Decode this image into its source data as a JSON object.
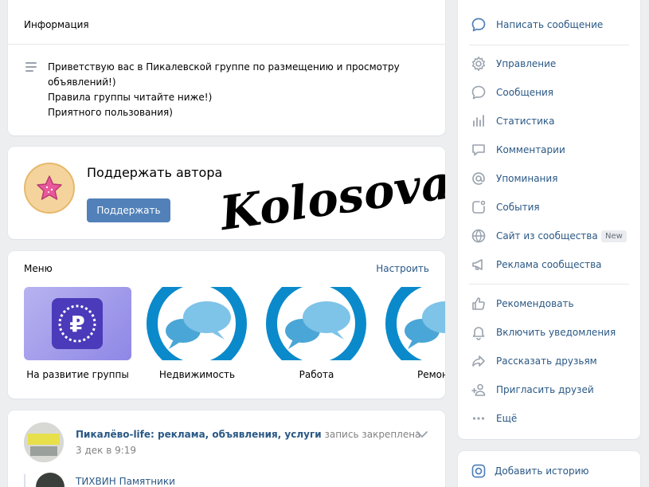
{
  "info": {
    "title": "Информация",
    "text": "Приветствую вас в Пикалевской группе по размещению и просмотру\nобъявлений!)\nПравила группы читайте ниже!)\nПриятного пользования)"
  },
  "support": {
    "title": "Поддержать автора",
    "button": "Поддержать",
    "signature": "Kolosova"
  },
  "menu": {
    "title": "Меню",
    "configure": "Настроить",
    "items": [
      {
        "label": "На развитие группы",
        "icon": "ruble-icon"
      },
      {
        "label": "Недвижимость",
        "icon": "chat-bubbles-icon"
      },
      {
        "label": "Работа",
        "icon": "chat-bubbles-icon"
      },
      {
        "label": "Ремонт",
        "icon": "chat-bubbles-icon"
      }
    ]
  },
  "post": {
    "author": "Пикалёво-life: реклама, объявления, услуги",
    "pinned": "запись закреплена",
    "date": "3 дек в 9:19",
    "repost_author": "ТИХВИН Памятники"
  },
  "sidebar": {
    "write_message": "Написать сообщение",
    "admin_items": [
      {
        "label": "Управление",
        "icon": "gear-icon"
      },
      {
        "label": "Сообщения",
        "icon": "message-icon"
      },
      {
        "label": "Статистика",
        "icon": "stats-icon"
      },
      {
        "label": "Комментарии",
        "icon": "comment-icon"
      },
      {
        "label": "Упоминания",
        "icon": "at-icon"
      },
      {
        "label": "События",
        "icon": "event-icon"
      },
      {
        "label": "Сайт из сообщества",
        "icon": "globe-icon",
        "badge": "New"
      },
      {
        "label": "Реклама сообщества",
        "icon": "megaphone-icon"
      }
    ],
    "action_items": [
      {
        "label": "Рекомендовать",
        "icon": "thumb-up-icon"
      },
      {
        "label": "Включить уведомления",
        "icon": "bell-icon"
      },
      {
        "label": "Рассказать друзьям",
        "icon": "share-icon"
      },
      {
        "label": "Пригласить друзей",
        "icon": "add-user-icon"
      },
      {
        "label": "Ещё",
        "icon": "more-icon"
      }
    ]
  },
  "story": {
    "label": "Добавить историю"
  },
  "colors": {
    "accent": "#5181b8",
    "link": "#2a5885",
    "icon": "#99a2ad",
    "chat_blue": "#0a8acb",
    "ruble_purple": "#4b3ab9"
  }
}
